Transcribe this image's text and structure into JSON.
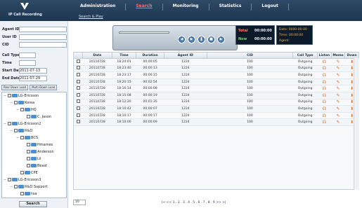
{
  "app": {
    "name": "IP Call Recording"
  },
  "nav": {
    "items": [
      {
        "label": "Administration"
      },
      {
        "label": "Search"
      },
      {
        "label": "Monitoring"
      },
      {
        "label": "Statistics"
      },
      {
        "label": "Logout"
      }
    ],
    "sub": "Search & Play"
  },
  "filters": {
    "agent_id": "Agent ID",
    "user_id": "User ID",
    "cid": "CID",
    "call_type": "Call Type",
    "time": "Time",
    "start_date_label": "Start Date",
    "start_date": "2011-07-13",
    "end_date_label": "End Date",
    "end_date": "2011-07-29",
    "btn1": "Real Down Load",
    "btn2": "Multi Down Load",
    "search": "Search"
  },
  "tree": [
    {
      "indent": 0,
      "label": "LG-Ericsson",
      "exp": "−"
    },
    {
      "indent": 1,
      "label": "Korea",
      "exp": "−"
    },
    {
      "indent": 2,
      "label": "HQ",
      "exp": "−"
    },
    {
      "indent": 3,
      "label": "C. Jason",
      "exp": ""
    },
    {
      "indent": 0,
      "label": "LG-Ericsson2",
      "exp": "−"
    },
    {
      "indent": 1,
      "label": "R&D",
      "exp": "−"
    },
    {
      "indent": 2,
      "label": "BCS",
      "exp": "−"
    },
    {
      "indent": 3,
      "label": "Hmames",
      "exp": ""
    },
    {
      "indent": 3,
      "label": "Anderson",
      "exp": ""
    },
    {
      "indent": 3,
      "label": "Lil",
      "exp": ""
    },
    {
      "indent": 3,
      "label": "Beast",
      "exp": ""
    },
    {
      "indent": 2,
      "label": "CPE",
      "exp": ""
    },
    {
      "indent": 0,
      "label": "LG-Ericsson3",
      "exp": "−"
    },
    {
      "indent": 1,
      "label": "R&D Support",
      "exp": "−"
    },
    {
      "indent": 2,
      "label": "lisa",
      "exp": ""
    }
  ],
  "stat": {
    "total_label": "Total",
    "total_val": "00:00:00",
    "now_label": "Now",
    "now_val": "00:00:00",
    "date_label": "Date:",
    "date_val": "0000-00-00",
    "time_label": "Time:",
    "time_val": "00:00:00",
    "agent_label": "Agent:"
  },
  "columns": [
    "",
    "Date",
    "Time",
    "Duration",
    "Agent ID",
    "CID",
    "Call Type",
    "Listen",
    "Memo",
    "Down"
  ],
  "rows": [
    [
      "20110728",
      "18:24:01",
      "00:00:05",
      "1224",
      "100",
      "Outgoing"
    ],
    [
      "20110728",
      "18:23:40",
      "00:00:13",
      "1224",
      "100",
      "Outgoing"
    ],
    [
      "20110728",
      "18:23:17",
      "00:00:15",
      "1224",
      "100",
      "Outgoing"
    ],
    [
      "20110728",
      "18:20:15",
      "00:02:54",
      "1224",
      "100",
      "Outgoing"
    ],
    [
      "20110728",
      "18:16:14",
      "00:00:08",
      "1224",
      "100",
      "Outgoing"
    ],
    [
      "20110728",
      "18:15:08",
      "00:00:19",
      "1224",
      "100",
      "Outgoing"
    ],
    [
      "20110728",
      "18:12:20",
      "00:01:35",
      "1224",
      "100",
      "Outgoing"
    ],
    [
      "20110728",
      "18:10:42",
      "00:00:07",
      "1224",
      "100",
      "Outgoing"
    ],
    [
      "20110728",
      "18:10:17",
      "00:00:17",
      "1224",
      "100",
      "Outgoing"
    ],
    [
      "20110728",
      "18:10:00",
      "00:00:09",
      "1224",
      "100",
      "Outgoing"
    ]
  ],
  "pager": {
    "page_size": "10",
    "text": "|< << 1 . 2 . 3 . 4 . 5 . 6 . 7 . 8 . 9 >> >|"
  }
}
